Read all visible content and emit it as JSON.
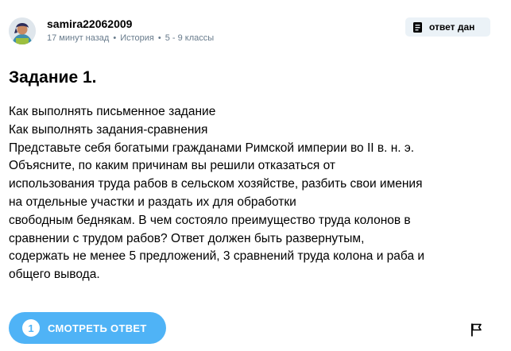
{
  "author": {
    "username": "samira22062009",
    "time_ago": "17 минут назад",
    "subject": "История",
    "grade": "5 - 9 классы",
    "avatar_icon": "user-avatar-icon"
  },
  "badge": {
    "label": "ответ дан",
    "icon": "document-icon"
  },
  "question": {
    "title": "Задание 1.",
    "lines": [
      "Как выполнять письменное задание",
      "Как выполнять задания-сравнения",
      "Представьте себя богатыми гражданами Римской империи во II в. н. э.",
      "Объясните, по каким причинам вы решили отказаться от",
      "использования труда рабов в сельском хозяйстве, разбить свои имения",
      "на отдельные участки и раздать их для обработки",
      "свободным беднякам. В чем состояло преимущество труда колонов в",
      "сравнении с трудом рабов? Ответ должен быть развернутым,",
      "содержать не менее 5 предложений, 3 сравнений труда колона и раба и",
      "общего вывода."
    ]
  },
  "actions": {
    "answers_count": "1",
    "see_answer_label": "СМОТРЕТЬ ОТВЕТ",
    "report_icon": "flag-icon"
  },
  "colors": {
    "accent_blue": "#4fb3f6",
    "meta_gray": "#687b8c",
    "badge_bg": "#ebf2f7"
  }
}
